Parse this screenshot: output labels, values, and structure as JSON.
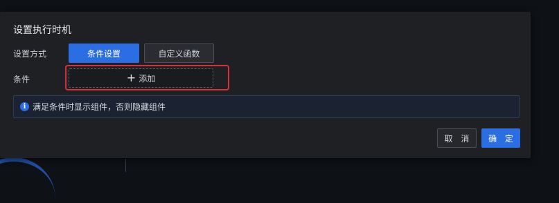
{
  "dialog": {
    "title": "设置执行时机",
    "mode_label": "设置方式",
    "mode_options": [
      "条件设置",
      "自定义函数"
    ],
    "selected_mode": "条件设置",
    "condition_label": "条件",
    "add_button_label": "添加",
    "info_text": "满足条件时显示组件，否则隐藏组件",
    "cancel_label": "取 消",
    "confirm_label": "确 定"
  },
  "icons": {
    "add": "plus-icon",
    "info": "info-icon"
  },
  "colors": {
    "primary": "#2b6de3",
    "highlight": "#d9303a",
    "dialog_bg": "#1f2024"
  }
}
